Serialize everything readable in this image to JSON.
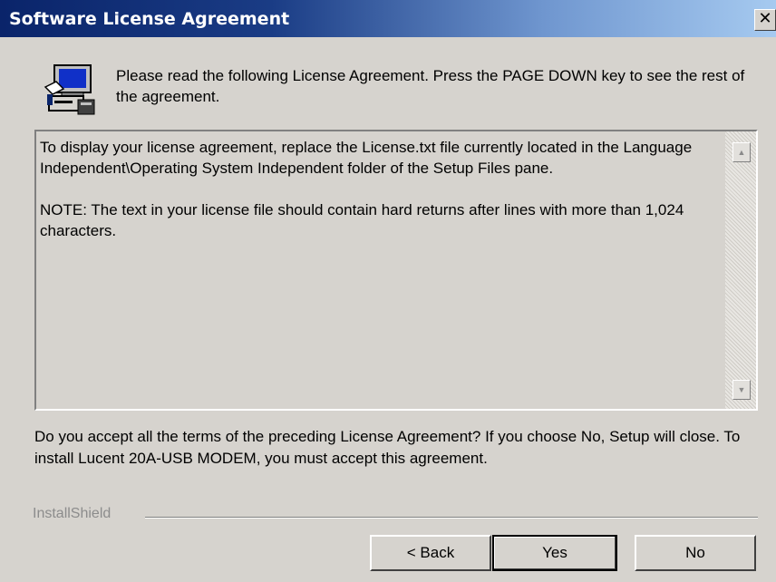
{
  "window": {
    "title": "Software License Agreement",
    "close_symbol": "✕"
  },
  "header": {
    "icon": "setup-computer-icon",
    "instructions": "Please read the following License Agreement.  Press the PAGE DOWN key to see the rest of the agreement."
  },
  "license": {
    "paragraphs": [
      "To display your license agreement, replace the License.txt file currently located in the Language Independent\\Operating System Independent folder of the Setup Files pane.",
      "NOTE: The text in your license file should contain hard returns after lines with more than 1,024 characters."
    ],
    "scroll_up_icon": "scroll-up-arrow-icon",
    "scroll_down_icon": "scroll-down-arrow-icon"
  },
  "question": "Do you accept all the terms of the preceding License Agreement?  If you choose No,  Setup will close.  To install Lucent 20A-USB MODEM, you must accept this agreement.",
  "footer": {
    "brand": "InstallShield",
    "buttons": {
      "back": "< Back",
      "yes": "Yes",
      "no": "No"
    }
  }
}
